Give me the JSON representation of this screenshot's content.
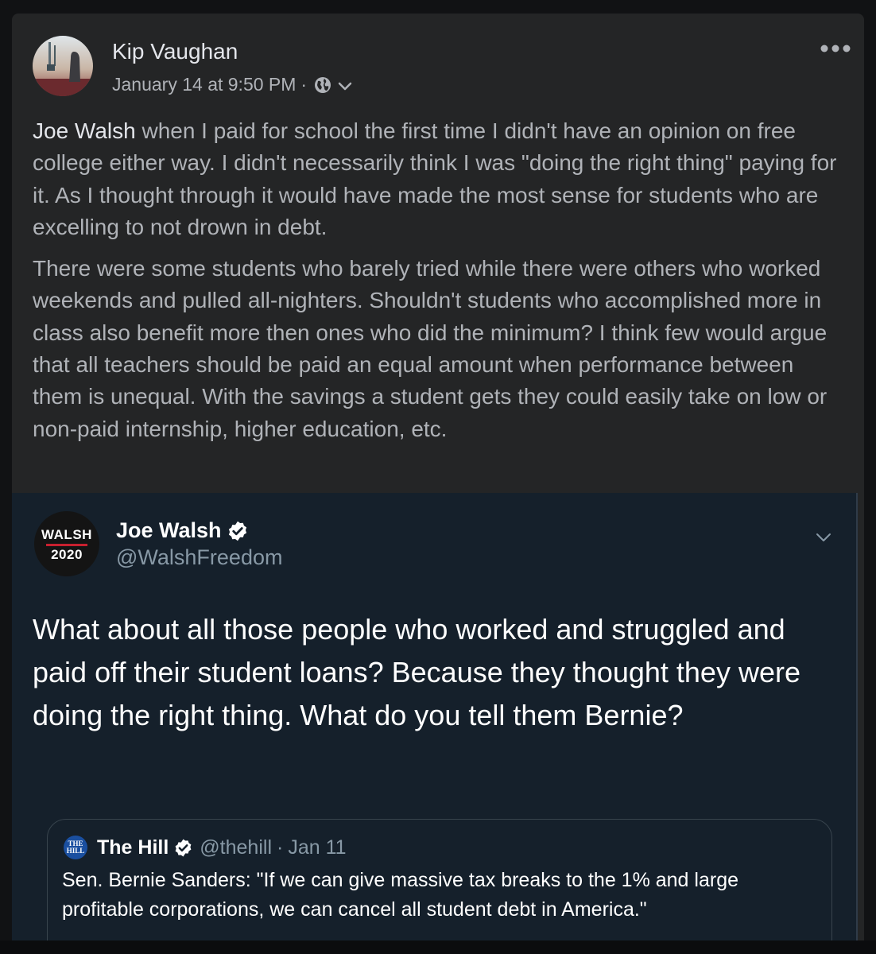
{
  "facebook_post": {
    "author": "Kip Vaughan",
    "timestamp": "January 14 at 9:50 PM",
    "separator": "·",
    "privacy_icon": "globe-icon",
    "mention": "Joe Walsh",
    "paragraph1": " when I paid for school the first time I didn't have an opinion on free college either way. I didn't necessarily think I was \"doing the right thing\" paying for it. As I thought through it would have made the most sense for students who are excelling to not drown in debt.",
    "paragraph2": "There were some students who barely tried while there were others who worked weekends and pulled all-nighters. Shouldn't students who accomplished more in class also benefit more then ones who did the minimum? I think few would argue that all teachers should be paid an equal amount when performance between them is unequal. With the savings a student gets they could easily take on low or non-paid internship, higher education, etc."
  },
  "tweet": {
    "avatar_line1": "WALSH",
    "avatar_line2": "2020",
    "name": "Joe Walsh",
    "handle": "@WalshFreedom",
    "text": "What about all those people who worked and struggled and paid off their student loans? Because they thought they were doing the right thing. What do you tell them Bernie?",
    "quoted": {
      "logo_text_1": "THE",
      "logo_text_2": "HILL",
      "name": "The Hill",
      "handle": "@thehill",
      "separator": "·",
      "date": "Jan 11",
      "text": "Sen. Bernie Sanders: \"If we can give massive tax breaks to the 1% and large profitable corporations, we can cancel all student debt in America.\""
    }
  },
  "colors": {
    "facebook_bg": "#242526",
    "twitter_bg": "#15202b",
    "verified_blue": "#ffffff",
    "walsh_red": "#c8202f"
  }
}
